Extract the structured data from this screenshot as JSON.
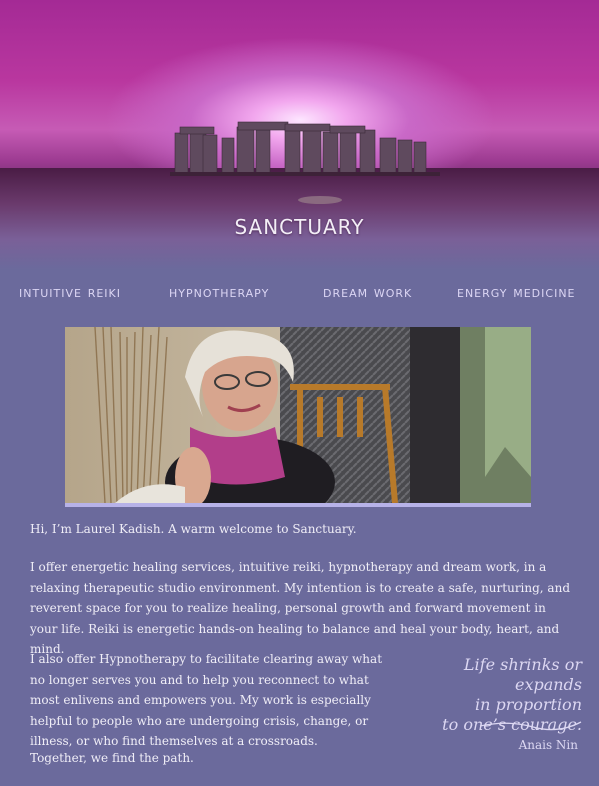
{
  "site": {
    "title": "sanctuary"
  },
  "nav": {
    "items": [
      {
        "label": "intuitive reiki"
      },
      {
        "label": "hypnotherapy"
      },
      {
        "label": "dream work"
      },
      {
        "label": "energy medicine"
      }
    ]
  },
  "content": {
    "greeting": "Hi, I’m Laurel Kadish.   A warm welcome to Sanctuary.",
    "para1": "I offer energetic healing services, intuitive reiki, hypnotherapy and dream work, in a relaxing therapeutic studio environment. My intention is to create a safe, nurturing, and reverent space for you to realize healing, personal growth and forward movement in your life. Reiki is energetic hands-on healing to balance and heal your body, heart, and mind.",
    "para2": "I also offer Hypnotherapy to facilitate clearing away what no longer serves you and to help you reconnect to what most enlivens and empowers you. My work is especially helpful to people who are undergoing crisis, change, or illness, or who find themselves at a crossroads.",
    "para3": "Together, we find the path."
  },
  "quote": {
    "line1": "Life shrinks or expands",
    "line2": "in proportion",
    "line3": "to one’s courage.",
    "author": "Anais Nin"
  },
  "colors": {
    "background": "#6b6a9c",
    "header_magenta": "#b9379f",
    "nav_text": "#dcd6f4",
    "body_text": "#f0eef7"
  }
}
